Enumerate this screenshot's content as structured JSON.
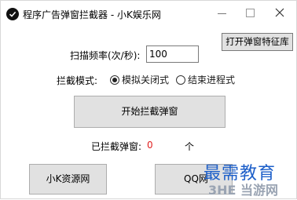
{
  "window": {
    "title": "程序广告弹窗拦截器 - 小K娱乐网"
  },
  "toolbar": {
    "feature_lib_label": "打开弹窗特征库"
  },
  "form": {
    "freq_label": "扫描频率(次/秒):",
    "freq_value": "100",
    "mode_label": "拦截模式:",
    "mode_options": [
      {
        "label": "模拟关闭式",
        "selected": true
      },
      {
        "label": "结束进程式",
        "selected": false
      }
    ]
  },
  "actions": {
    "start_label": "开始拦截弹窗",
    "resource_label": "小K资源网",
    "qq_label": "QQ网"
  },
  "status": {
    "count_label": "已拦截弹窗:",
    "count_value": "0",
    "count_unit": "个"
  },
  "watermark": {
    "main": "最需教育",
    "sub": "3HE 当游网"
  },
  "colors": {
    "count_value": "#e02020",
    "watermark_main": "#1d5fc9"
  }
}
